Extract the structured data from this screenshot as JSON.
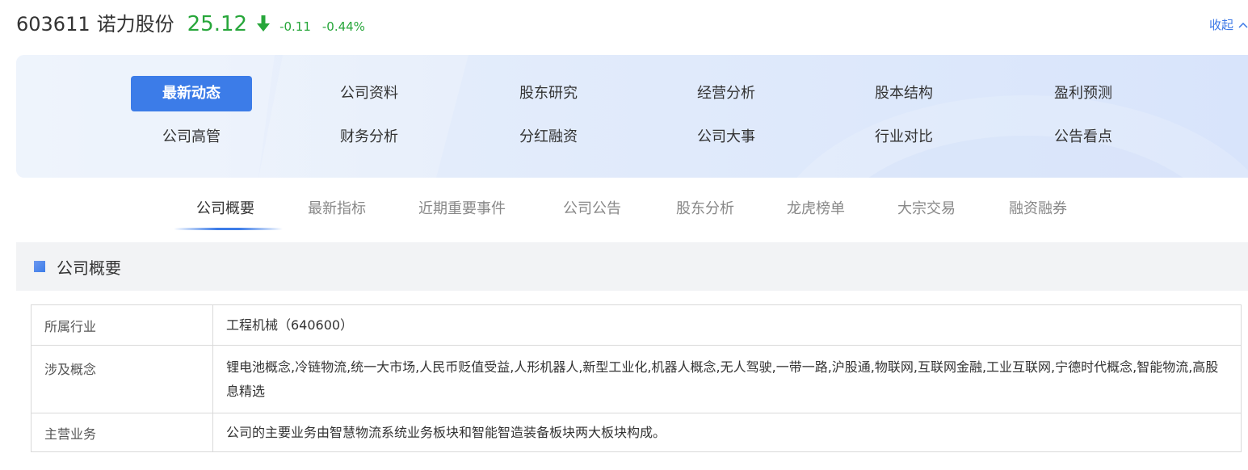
{
  "stock": {
    "code": "603611",
    "name": "诺力股份",
    "price": "25.12",
    "change": "-0.11",
    "change_pct": "-0.44%",
    "trend_icon": "down-arrow-icon",
    "trend_color": "#27a63a"
  },
  "header": {
    "collapse_label": "收起"
  },
  "nav": {
    "active_color": "#3c7ce8",
    "items": [
      {
        "label": "最新动态",
        "active": true
      },
      {
        "label": "公司资料"
      },
      {
        "label": "股东研究"
      },
      {
        "label": "经营分析"
      },
      {
        "label": "股本结构"
      },
      {
        "label": "盈利预测"
      },
      {
        "label": "公司高管"
      },
      {
        "label": "财务分析"
      },
      {
        "label": "分红融资"
      },
      {
        "label": "公司大事"
      },
      {
        "label": "行业对比"
      },
      {
        "label": "公告看点"
      }
    ]
  },
  "subtabs": [
    {
      "label": "公司概要",
      "active": true
    },
    {
      "label": "最新指标"
    },
    {
      "label": "近期重要事件"
    },
    {
      "label": "公司公告"
    },
    {
      "label": "股东分析"
    },
    {
      "label": "龙虎榜单"
    },
    {
      "label": "大宗交易"
    },
    {
      "label": "融资融券"
    }
  ],
  "section": {
    "title": "公司概要"
  },
  "overview": {
    "rows": [
      {
        "label": "所属行业",
        "value": "工程机械（640600）"
      },
      {
        "label": "涉及概念",
        "value": "锂电池概念,冷链物流,统一大市场,人民币贬值受益,人形机器人,新型工业化,机器人概念,无人驾驶,一带一路,沪股通,物联网,互联网金融,工业互联网,宁德时代概念,智能物流,高股息精选"
      },
      {
        "label": "主营业务",
        "value": "公司的主要业务由智慧物流系统业务板块和智能智造装备板块两大板块构成。"
      }
    ]
  }
}
